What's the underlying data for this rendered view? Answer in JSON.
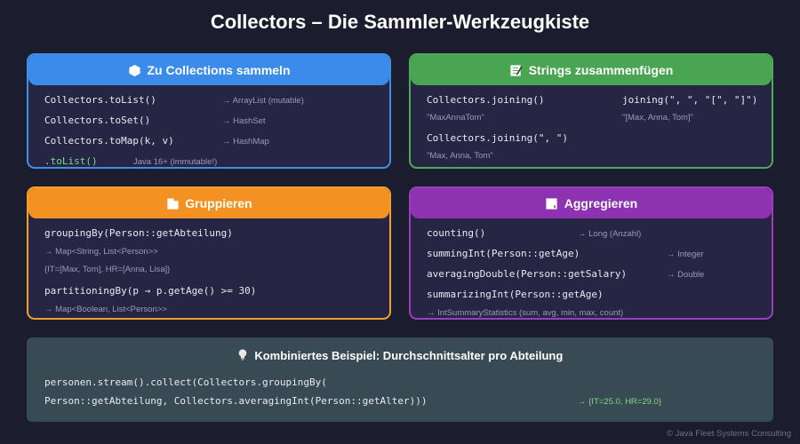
{
  "title": "Collectors – Die Sammler-Werkzeugkiste",
  "collections": {
    "header": "Zu Collections sammeln",
    "icon": "hexagon-icon",
    "rows": [
      {
        "code": "Collectors.toList()",
        "note": "→ ArrayList (mutable)"
      },
      {
        "code": "Collectors.toSet()",
        "note": "→ HashSet"
      },
      {
        "code": "Collectors.toMap(k, v)",
        "note": "→ HashMap"
      },
      {
        "code": ".toList()",
        "note": "Java 16+ (immutable!)"
      }
    ]
  },
  "strings": {
    "header": "Strings zusammenfügen",
    "icon": "memo-icon",
    "rows": [
      {
        "code": "Collectors.joining()",
        "note": "\"MaxAnnaTom\""
      },
      {
        "code": "joining(\", \", \"[\", \"]\")",
        "note": "\"[Max, Anna, Tom]\""
      },
      {
        "code": "Collectors.joining(\", \")",
        "note": "\"Max, Anna, Tom\""
      }
    ]
  },
  "grouping": {
    "header": "Gruppieren",
    "icon": "folder-icon",
    "rows": [
      {
        "code": "groupingBy(Person::getAbteilung)",
        "note": "→ Map<String, List<Person>>"
      },
      {
        "note": "{IT=[Max, Tom], HR=[Anna, Lisa]}"
      },
      {
        "code": "partitioningBy(p → p.getAge() >= 30)",
        "note": "→ Map<Boolean, List<Person>>"
      }
    ]
  },
  "aggregate": {
    "header": "Aggregieren",
    "icon": "chart-icon",
    "rows": [
      {
        "code": "counting()",
        "note": "→ Long (Anzahl)"
      },
      {
        "code": "summingInt(Person::getAge)",
        "note": "→ Integer"
      },
      {
        "code": "averagingDouble(Person::getSalary)",
        "note": "→ Double"
      },
      {
        "code": "summarizingInt(Person::getAge)",
        "note": "→ IntSummaryStatistics (sum, avg, min, max, count)"
      }
    ]
  },
  "example": {
    "header": "Kombiniertes Beispiel: Durchschnittsalter pro Abteilung",
    "icon": "lightbulb-icon",
    "line1": "personen.stream().collect(Collectors.groupingBy(",
    "line2": "Person::getAbteilung, Collectors.averagingInt(Person::getAlter)))",
    "result": "→ {IT=25.0, HR=29.0}"
  },
  "footer": "© Java Fleet Systems Consulting",
  "colors": {
    "collections": "#3a8bea",
    "strings": "#4aa552",
    "grouping": "#f39222",
    "aggregate": "#8d32b0",
    "example": "#384a53",
    "background": "#1c1c2f"
  }
}
